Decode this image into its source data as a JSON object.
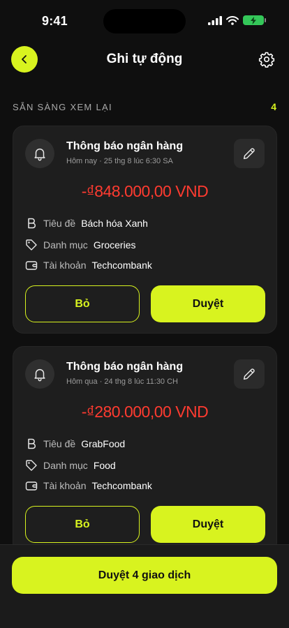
{
  "status_bar": {
    "time": "9:41",
    "battery_color": "#34c759"
  },
  "header": {
    "title": "Ghi tự động",
    "back_icon": "chevron-left-icon",
    "settings_icon": "gear-icon"
  },
  "section": {
    "label": "SẴN SÀNG XEM LẠI",
    "count": "4"
  },
  "cards": [
    {
      "icon": "bell-icon",
      "title": "Thông báo ngân hàng",
      "subtitle": "Hôm nay · 25 thg 8 lúc 6:30 SA",
      "amount": "-₫848.000,00 VND",
      "payee_label": "Tiêu đề",
      "payee": "Bách hóa Xanh",
      "category_label": "Danh mục",
      "category": "Groceries",
      "account_label": "Tài khoản",
      "account": "Techcombank",
      "skip_label": "Bỏ",
      "approve_label": "Duyệt"
    },
    {
      "icon": "bell-icon",
      "title": "Thông báo ngân hàng",
      "subtitle": "Hôm qua · 24 thg 8 lúc 11:30 CH",
      "amount": "-₫280.000,00 VND",
      "payee_label": "Tiêu đề",
      "payee": "GrabFood",
      "category_label": "Danh mục",
      "category": "Food",
      "account_label": "Tài khoản",
      "account": "Techcombank",
      "skip_label": "Bỏ",
      "approve_label": "Duyệt"
    }
  ],
  "footer": {
    "approve_all_label": "Duyệt 4 giao dịch"
  },
  "colors": {
    "accent": "#d8f31f",
    "expense": "#ff3b30",
    "background": "#0f0f0f",
    "card": "#1e1e1e"
  }
}
